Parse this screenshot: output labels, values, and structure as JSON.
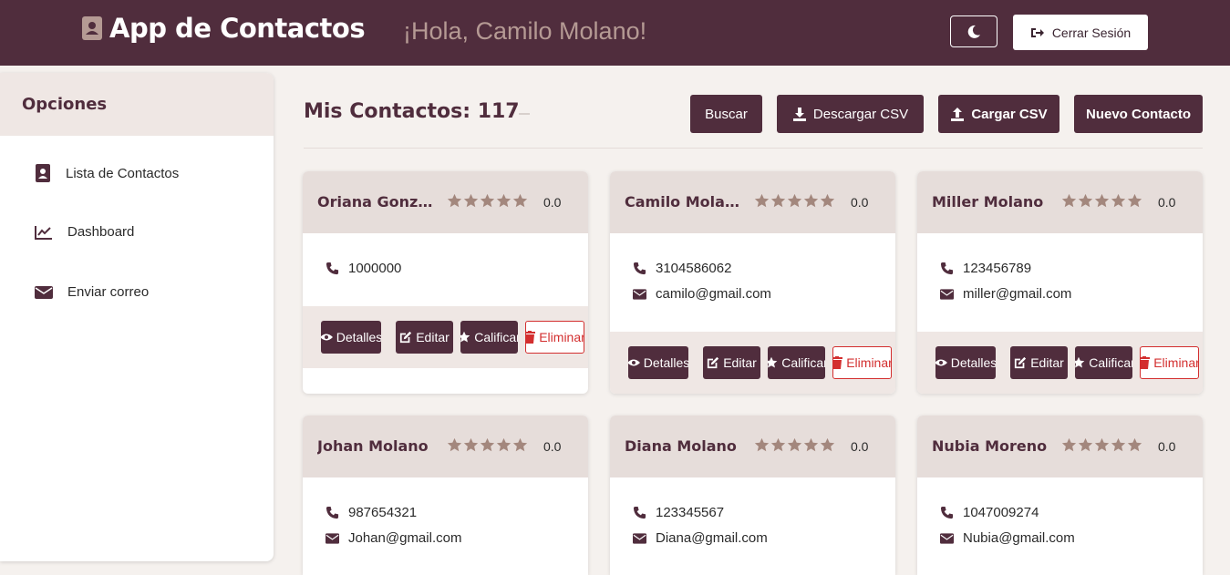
{
  "header": {
    "title": "App de Contactos",
    "greeting": "¡Hola, Camilo Molano!",
    "logout_label": "Cerrar Sesión"
  },
  "sidebar": {
    "title": "Opciones",
    "items": [
      {
        "label": "Lista de Contactos",
        "icon": "contact-book-icon"
      },
      {
        "label": "Dashboard",
        "icon": "chart-line-icon"
      },
      {
        "label": "Enviar correo",
        "icon": "envelope-icon"
      }
    ]
  },
  "main": {
    "title": "Mis Contactos: 117",
    "buttons": {
      "search": "Buscar",
      "download_csv": "Descargar CSV",
      "upload_csv": "Cargar CSV",
      "new_contact": "Nuevo Contacto"
    }
  },
  "card_actions": {
    "details": "Detalles",
    "edit": "Editar",
    "rate": "Calificar",
    "delete": "Eliminar"
  },
  "contacts": [
    {
      "name": "Oriana Gonza...",
      "rating": "0.0",
      "phone": "1000000",
      "email": ""
    },
    {
      "name": "Camilo Molano",
      "rating": "0.0",
      "phone": "3104586062",
      "email": "camilo@gmail.com"
    },
    {
      "name": "Miller Molano",
      "rating": "0.0",
      "phone": "123456789",
      "email": "miller@gmail.com"
    },
    {
      "name": "Johan Molano",
      "rating": "0.0",
      "phone": "987654321",
      "email": "Johan@gmail.com"
    },
    {
      "name": "Diana Molano",
      "rating": "0.0",
      "phone": "123345567",
      "email": "Diana@gmail.com"
    },
    {
      "name": "Nubia Moreno",
      "rating": "0.0",
      "phone": "1047009274",
      "email": "Nubia@gmail.com"
    }
  ],
  "colors": {
    "primary": "#502d3d",
    "star": "#a3877d",
    "danger": "#d32f2f"
  }
}
